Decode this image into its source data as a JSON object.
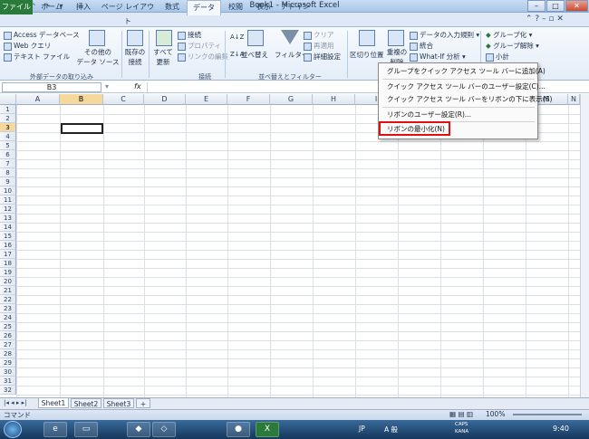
{
  "app": {
    "title": "Book1 - Microsoft Excel",
    "icon": "excel-icon"
  },
  "tabs": [
    "ファイル",
    "ホーム",
    "挿入",
    "ページ レイアウト",
    "数式",
    "データ",
    "校閲",
    "表示",
    "アドイン"
  ],
  "active_tab": "データ",
  "ribbon": {
    "external_data": {
      "items": [
        "Access データベース",
        "Web クエリ",
        "テキスト ファイル"
      ],
      "other_label1": "その他の",
      "other_label2": "データ ソース",
      "group_label": "外部データの取り込み"
    },
    "connections": {
      "existing1": "既存の",
      "existing2": "接続",
      "refresh1": "すべて",
      "refresh2": "更新",
      "items": [
        "接続",
        "プロパティ",
        "リンクの編集"
      ],
      "group_label": "接続"
    },
    "sort_filter": {
      "sort": "並べ替え",
      "filter": "フィルター",
      "items": [
        "クリア",
        "再適用",
        "詳細設定"
      ],
      "group_label": "並べ替えとフィルター"
    },
    "data_tools": {
      "text_to_col": "区切り位置",
      "dup1": "重複の",
      "dup2": "削除",
      "items": [
        "データの入力規則",
        "統合",
        "What-If 分析"
      ]
    },
    "outline": {
      "items": [
        "グループ化",
        "グループ解除",
        "小計"
      ]
    }
  },
  "formula_bar": {
    "cell_ref": "B3",
    "fx": "fx",
    "value": ""
  },
  "columns": [
    "A",
    "B",
    "C",
    "D",
    "E",
    "F",
    "G",
    "H",
    "I",
    "J",
    "K",
    "L",
    "M",
    "N"
  ],
  "rows": [
    "1",
    "2",
    "3",
    "4",
    "5",
    "6",
    "7",
    "8",
    "9",
    "10",
    "11",
    "12",
    "13",
    "14",
    "15",
    "16",
    "17",
    "18",
    "19",
    "20",
    "21",
    "22",
    "23",
    "24",
    "25",
    "26",
    "27",
    "28",
    "29",
    "30",
    "31",
    "32"
  ],
  "selected": {
    "column": "B",
    "row": "3"
  },
  "context_menu": {
    "items": [
      "グループをクイック アクセス ツール バーに追加(A)",
      "クイック アクセス ツール バーのユーザー設定(C)...",
      "クイック アクセス ツール バーをリボンの下に表示(S)",
      "リボンのユーザー設定(R)...",
      "リボンの最小化(N)"
    ],
    "highlighted": "リボンの最小化(N)"
  },
  "sheets": [
    "Sheet1",
    "Sheet2",
    "Sheet3"
  ],
  "active_sheet": "Sheet1",
  "status": {
    "mode": "コマンド",
    "zoom": "100%"
  },
  "taskbar": {
    "ime": "JP",
    "ime_mode": "A 般",
    "caps": "CAPS",
    "kana": "KANA",
    "time": "9:40"
  }
}
